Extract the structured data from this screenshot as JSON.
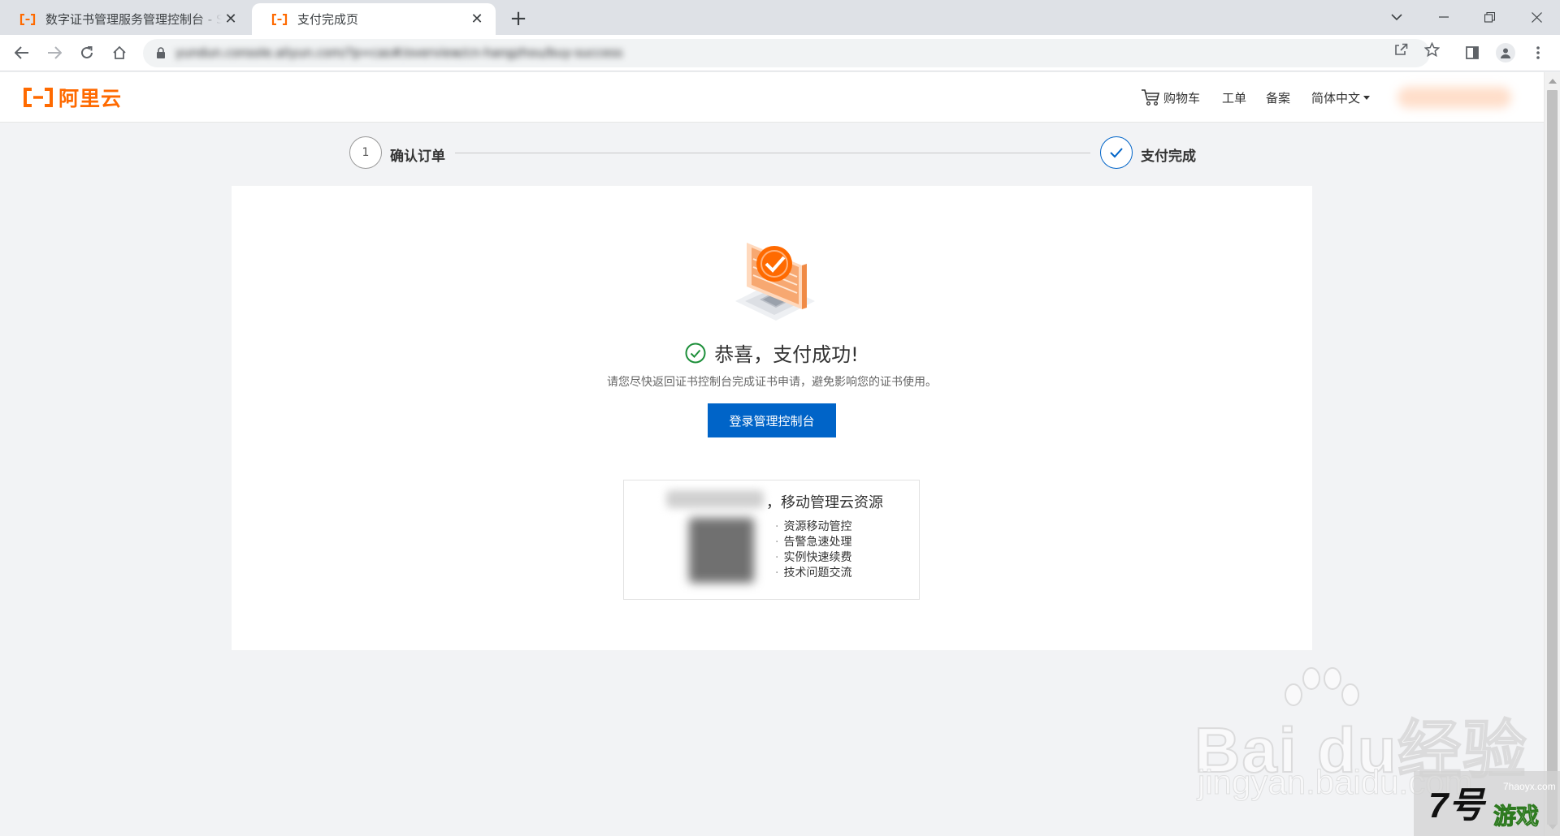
{
  "browser": {
    "tabs": [
      {
        "title": "数字证书管理服务管理控制台 - SSL",
        "active": false
      },
      {
        "title": "支付完成页",
        "active": true
      }
    ],
    "url": "yundun.console.aliyun.com/?p=cas#/overview/cn-hangzhou/buy-success"
  },
  "header": {
    "logo_text": "阿里云",
    "nav": {
      "cart": "购物车",
      "ticket": "工单",
      "icp": "备案",
      "language": "简体中文"
    }
  },
  "steps": [
    {
      "index": "1",
      "label": "确认订单",
      "status": "done"
    },
    {
      "index": "✓",
      "label": "支付完成",
      "status": "current"
    }
  ],
  "result": {
    "title": "恭喜，支付成功!",
    "description": "请您尽快返回证书控制台完成证书申请，避免影响您的证书使用。",
    "button_label": "登录管理控制台"
  },
  "mobile_promo": {
    "title": "，移动管理云资源",
    "features": [
      "资源移动管控",
      "告警急速处理",
      "实例快速续费",
      "技术问题交流"
    ]
  },
  "watermarks": {
    "baidu_brand": "Bai du经验",
    "baidu_url": "jingyan.baidu.com",
    "game_logo": "7号",
    "game_name": "游戏",
    "game_site": "7haoyx.com"
  },
  "colors": {
    "brand_orange": "#ff6a00",
    "primary_blue": "#0064c8",
    "success_green": "#1d8f3a"
  }
}
